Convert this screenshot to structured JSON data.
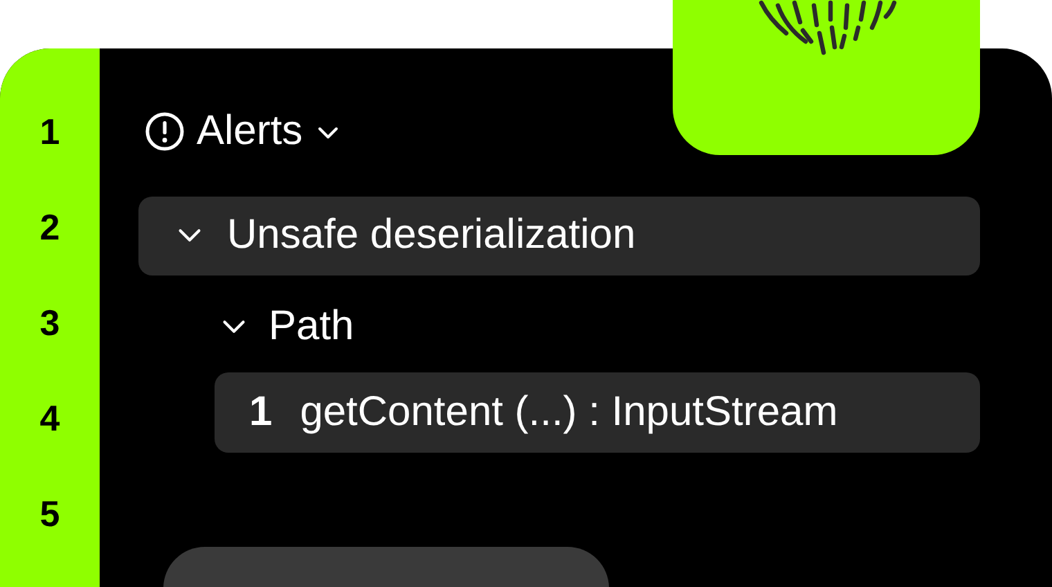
{
  "gutter": {
    "line_numbers": [
      "1",
      "2",
      "3",
      "4",
      "5"
    ]
  },
  "alerts": {
    "title": "Alerts",
    "expanded": true,
    "items": [
      {
        "label": "Unsafe deserialization",
        "expanded": true,
        "children": [
          {
            "label": "Path",
            "expanded": true,
            "steps": [
              {
                "number": "1",
                "label": "getContent (...) : InputStream"
              }
            ]
          }
        ]
      }
    ]
  }
}
